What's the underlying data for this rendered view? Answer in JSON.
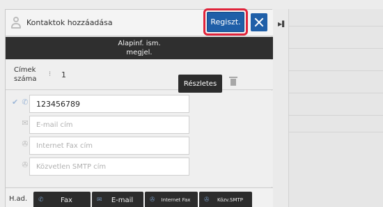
{
  "dialog": {
    "title": "Kontaktok hozzáadása",
    "register_label": "Regiszt.",
    "basic_info_label_line1": "Alapinf. ism.",
    "basic_info_label_line2": "megjel."
  },
  "address_count": {
    "label_line1": "Címek",
    "label_line2": "száma",
    "value": "1"
  },
  "form": {
    "phone_value": "123456789",
    "email_placeholder": "E-mail cím",
    "internet_fax_placeholder": "Internet Fax cím",
    "smtp_placeholder": "Közvetlen SMTP cím",
    "details_label": "Részletes"
  },
  "tabs": {
    "label": "H.ad.",
    "items": [
      {
        "label": "Fax",
        "icon": "phone-icon"
      },
      {
        "label": "E-mail",
        "icon": "envelope-icon"
      },
      {
        "label": "Internet Fax",
        "icon": "internet-fax-icon"
      },
      {
        "label": "Közv.SMTP",
        "icon": "smtp-icon"
      }
    ]
  },
  "colors": {
    "accent_blue": "#1f5fa8",
    "highlight_red": "#e0233a",
    "dark_bar": "#2f2f2f"
  },
  "icons": [
    "user-icon",
    "close-icon",
    "check-icon",
    "phone-icon",
    "envelope-icon",
    "internet-fax-icon",
    "smtp-icon",
    "trash-icon",
    "collapse-arrow-icon"
  ]
}
